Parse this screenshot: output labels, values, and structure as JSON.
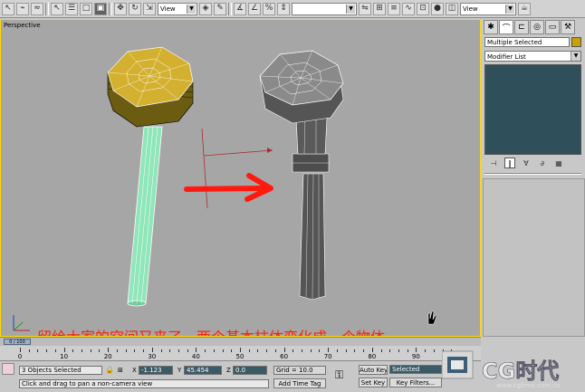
{
  "toolbar": {
    "view_dropdown_1": "View",
    "view_dropdown_2": "View",
    "selection_set_field": ""
  },
  "viewport": {
    "label": "Perspective",
    "caption": "留给大家的空间又来了，两个基本柱体变化成一个物体。"
  },
  "command_panel": {
    "selection_label": "Multiple Selected",
    "modifier_list": "Modifier List",
    "selection_color": "#c8a000"
  },
  "timeline": {
    "slider_label": "0 / 100",
    "ruler_ticks": [
      "0",
      "10",
      "20",
      "30",
      "40",
      "50",
      "60",
      "70",
      "80",
      "90",
      "100"
    ]
  },
  "status": {
    "selection_count": "3 Objects Selected",
    "prompt": "Click and drag to pan a non-camera view",
    "x_label": "X",
    "x_value": "-1.123",
    "y_label": "Y",
    "y_value": "45.454",
    "z_label": "Z",
    "z_value": "0.0",
    "grid": "Grid = 10.0",
    "add_time_tag": "Add Time Tag",
    "auto_key": "Auto Key",
    "set_key": "Set Key",
    "key_mode": "Selected",
    "key_filters": "Key Filters..."
  },
  "watermark": {
    "brand": "CG时代",
    "url": "www.cgtime.com.cn"
  }
}
